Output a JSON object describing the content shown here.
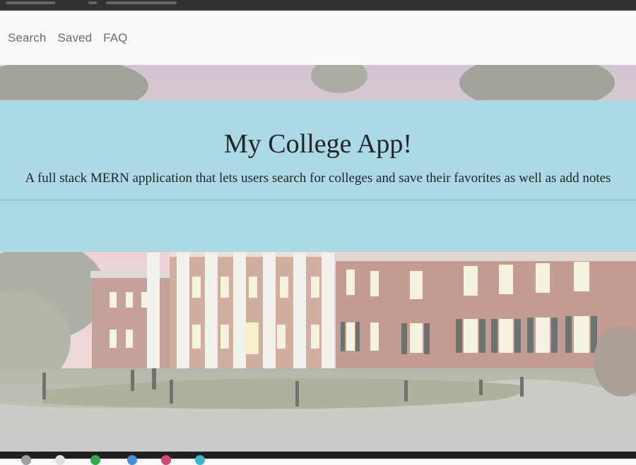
{
  "nav": {
    "links": [
      {
        "label": "Search"
      },
      {
        "label": "Saved"
      },
      {
        "label": "FAQ"
      }
    ]
  },
  "jumbotron": {
    "title": "My College App!",
    "lead": "A full stack MERN application that lets users search for colleges and save their favorites as well as add notes"
  },
  "colors": {
    "jumbotron_bg": "#add8e6",
    "navbar_bg": "#f8f9fa",
    "nav_link": "#6c6c6c"
  }
}
